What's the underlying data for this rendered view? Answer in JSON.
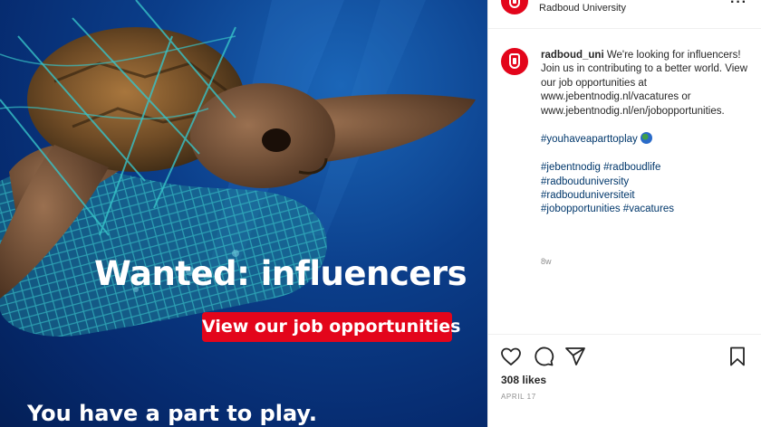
{
  "post": {
    "headline": "Wanted: influencers",
    "cta_label": "View our job opportunities",
    "tagline": "You have a part to play."
  },
  "account": {
    "display_name": "Radboud University",
    "username": "radboud_uni"
  },
  "caption": {
    "text": "We're looking for influencers! Join us in contributing to a better world. View our job opportunities at www.jebentnodig.nl/vacatures or www.jebentnodig.nl/en/jobopportunities.",
    "tag_line_1": "#youhaveaparttoplay",
    "tags": [
      "#jebentnodig",
      "#radboudlife",
      "#radbouduniversity",
      "#radbouduniversiteit",
      "#jobopportunities",
      "#vacatures"
    ],
    "age": "8w"
  },
  "engagement": {
    "likes": "308 likes",
    "date": "APRIL 17"
  },
  "icons": {
    "like": "heart-icon",
    "comment": "comment-icon",
    "share": "share-icon",
    "save": "bookmark-icon",
    "more": "more-options-icon",
    "globe": "globe-emoji-icon"
  },
  "colors": {
    "brand_red": "#e3051b",
    "hashtag": "#00376b",
    "muted": "#8e8e8e",
    "ocean": "#0b3e8a"
  }
}
